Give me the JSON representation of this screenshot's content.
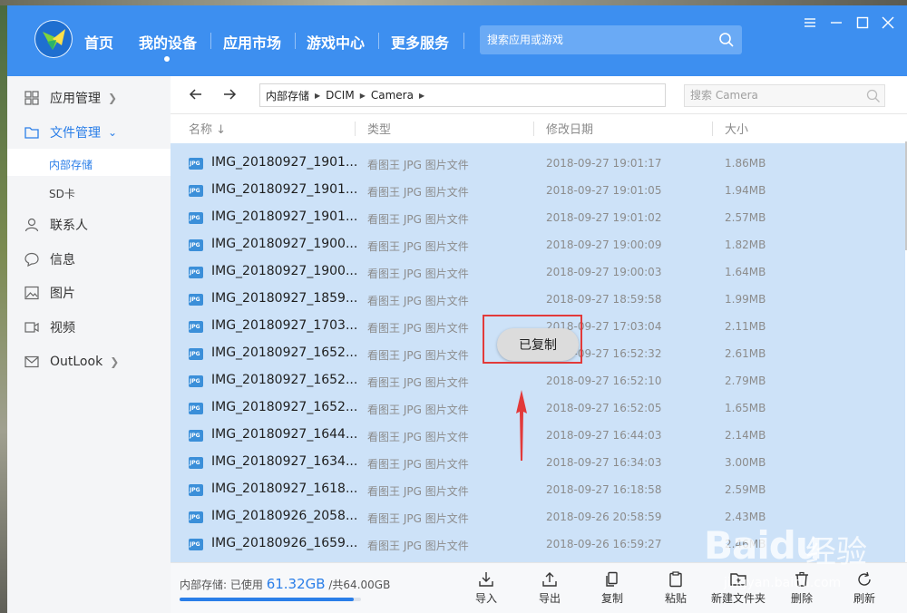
{
  "app": {
    "nav": [
      "首页",
      "我的设备",
      "应用市场",
      "游戏中心",
      "更多服务"
    ],
    "search_placeholder": "搜索应用或游戏"
  },
  "sidebar": {
    "items": [
      {
        "label": "应用管理",
        "icon": "grid-icon"
      },
      {
        "label": "文件管理",
        "icon": "folder-icon"
      },
      {
        "label": "联系人",
        "icon": "contact-icon"
      },
      {
        "label": "信息",
        "icon": "message-icon"
      },
      {
        "label": "图片",
        "icon": "image-icon"
      },
      {
        "label": "视频",
        "icon": "video-icon"
      },
      {
        "label": "OutLook",
        "icon": "mail-icon"
      }
    ],
    "sub_items": [
      "内部存储",
      "SD卡"
    ]
  },
  "path": {
    "crumbs": [
      "内部存储",
      "DCIM",
      "Camera"
    ],
    "search_placeholder": "搜索 Camera"
  },
  "columns": {
    "name": "名称 ↓",
    "type": "类型",
    "date": "修改日期",
    "size": "大小"
  },
  "files": [
    {
      "name": "IMG_20180927_1901...",
      "type": "看图王 JPG 图片文件",
      "date": "2018-09-27 19:01:17",
      "size": "1.86MB"
    },
    {
      "name": "IMG_20180927_1901...",
      "type": "看图王 JPG 图片文件",
      "date": "2018-09-27 19:01:05",
      "size": "1.94MB"
    },
    {
      "name": "IMG_20180927_1901...",
      "type": "看图王 JPG 图片文件",
      "date": "2018-09-27 19:01:02",
      "size": "2.57MB"
    },
    {
      "name": "IMG_20180927_1900...",
      "type": "看图王 JPG 图片文件",
      "date": "2018-09-27 19:00:09",
      "size": "1.82MB"
    },
    {
      "name": "IMG_20180927_1900...",
      "type": "看图王 JPG 图片文件",
      "date": "2018-09-27 19:00:03",
      "size": "1.64MB"
    },
    {
      "name": "IMG_20180927_1859...",
      "type": "看图王 JPG 图片文件",
      "date": "2018-09-27 18:59:58",
      "size": "1.99MB"
    },
    {
      "name": "IMG_20180927_1703...",
      "type": "看图王 JPG 图片文件",
      "date": "2018-09-27 17:03:04",
      "size": "2.11MB"
    },
    {
      "name": "IMG_20180927_1652...",
      "type": "看图王 JPG 图片文件",
      "date": "2018-09-27 16:52:32",
      "size": "2.61MB"
    },
    {
      "name": "IMG_20180927_1652...",
      "type": "看图王 JPG 图片文件",
      "date": "2018-09-27 16:52:10",
      "size": "2.79MB"
    },
    {
      "name": "IMG_20180927_1652...",
      "type": "看图王 JPG 图片文件",
      "date": "2018-09-27 16:52:05",
      "size": "1.65MB"
    },
    {
      "name": "IMG_20180927_1644...",
      "type": "看图王 JPG 图片文件",
      "date": "2018-09-27 16:44:03",
      "size": "2.14MB"
    },
    {
      "name": "IMG_20180927_1634...",
      "type": "看图王 JPG 图片文件",
      "date": "2018-09-27 16:34:03",
      "size": "3.00MB"
    },
    {
      "name": "IMG_20180927_1618...",
      "type": "看图王 JPG 图片文件",
      "date": "2018-09-27 16:18:58",
      "size": "2.59MB"
    },
    {
      "name": "IMG_20180926_2058...",
      "type": "看图王 JPG 图片文件",
      "date": "2018-09-26 20:58:59",
      "size": "2.43MB"
    },
    {
      "name": "IMG_20180926_1659...",
      "type": "看图王 JPG 图片文件",
      "date": "2018-09-26 16:59:27",
      "size": "2.46MB"
    }
  ],
  "file_icon_text": "JPG",
  "toast": "已复制",
  "storage": {
    "label": "内部存储: 已使用",
    "used": "61.32GB",
    "total": "/共64.00GB",
    "used_fraction": 0.958
  },
  "toolbar": [
    "导入",
    "导出",
    "复制",
    "粘贴",
    "新建文件夹",
    "删除",
    "刷新"
  ],
  "watermark": {
    "text": "Baidu",
    "text2": "经验",
    "url": "jingyan.baidu.com"
  },
  "colors": {
    "titlebar": "#3d8ff0",
    "accent": "#2a7ee8",
    "selection": "#cde2f8",
    "annotation": "#e23a3a"
  }
}
